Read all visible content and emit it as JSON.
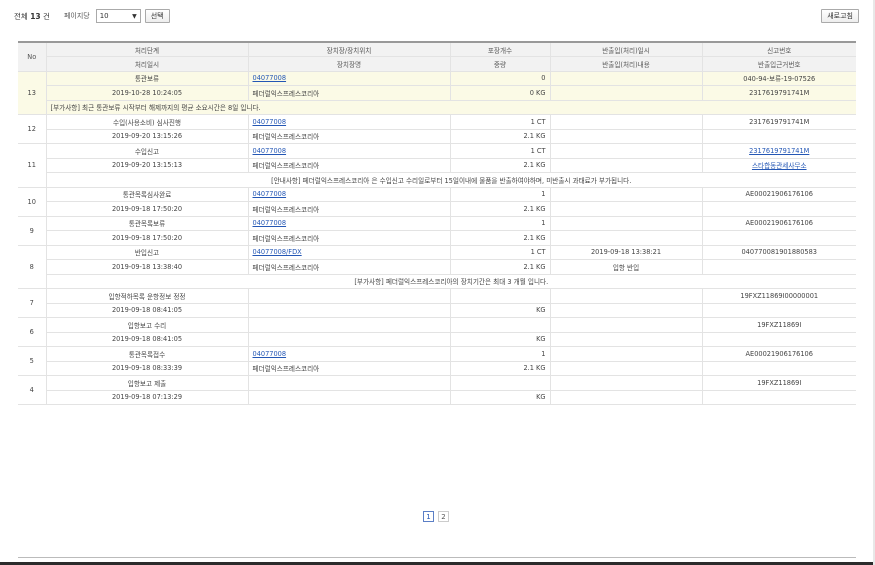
{
  "toolbar": {
    "total_prefix": "전체",
    "total_count": "13",
    "total_suffix": "건",
    "per_page_label": "페이지당",
    "per_page_value": "10",
    "select_button": "선택",
    "refresh_button": "새로고침"
  },
  "table": {
    "headers": {
      "no": "No",
      "row1": [
        "처리단계",
        "장치장/장치위치",
        "포장개수",
        "반출입(처리)일시",
        "신고번호"
      ],
      "row2": [
        "처리일시",
        "장치장명",
        "중량",
        "반출입(처리)내용",
        "반출입근거번호"
      ]
    },
    "records": [
      {
        "no": "13",
        "highlight": true,
        "step": "통관보류",
        "location": "04077008",
        "location_link": true,
        "count": "0",
        "io_datetime": "",
        "decl_no": "040-94-보류-19-07526",
        "decl_link": false,
        "datetime": "2019-10-28 10:24:05",
        "warehouse": "페더럴익스프레스코리아",
        "weight": "0 KG",
        "io_content": "",
        "basis_no": "2317619791741M",
        "basis_link": false,
        "notice": "[부가사항] 최근 통관보류 시작부터 해제까지의 평균 소요시간은 8일 입니다."
      },
      {
        "no": "12",
        "highlight": false,
        "step": "수입(사용소비) 심사진행",
        "location": "04077008",
        "location_link": true,
        "count": "1 CT",
        "io_datetime": "",
        "decl_no": "2317619791741M",
        "decl_link": false,
        "datetime": "2019-09-20 13:15:26",
        "warehouse": "페더럴익스프레스코리아",
        "weight": "2.1 KG",
        "io_content": "",
        "basis_no": "",
        "basis_link": false,
        "notice": ""
      },
      {
        "no": "11",
        "highlight": false,
        "step": "수입신고",
        "location": "04077008",
        "location_link": true,
        "count": "1 CT",
        "io_datetime": "",
        "decl_no": "2317619791741M",
        "decl_link": true,
        "datetime": "2019-09-20 13:15:13",
        "warehouse": "페더럴익스프레스코리아",
        "weight": "2.1 KG",
        "io_content": "",
        "basis_no": "스타합동관세사무소",
        "basis_link": true,
        "notice": "[안내사항] 페더럴익스프레스코리아 은 수입신고 수리일로부터 15일이내에 물품을 반출하여야하며, 미반출시 과태료가 부가됩니다."
      },
      {
        "no": "10",
        "highlight": false,
        "step": "통관목록심사완료",
        "location": "04077008",
        "location_link": true,
        "count": "1",
        "io_datetime": "",
        "decl_no": "AE00021906176106",
        "decl_link": false,
        "datetime": "2019-09-18 17:50:20",
        "warehouse": "페더럴익스프레스코리아",
        "weight": "2.1 KG",
        "io_content": "",
        "basis_no": "",
        "basis_link": false,
        "notice": ""
      },
      {
        "no": "9",
        "highlight": false,
        "step": "통관목록보류",
        "location": "04077008",
        "location_link": true,
        "count": "1",
        "io_datetime": "",
        "decl_no": "AE00021906176106",
        "decl_link": false,
        "datetime": "2019-09-18 17:50:20",
        "warehouse": "페더럴익스프레스코리아",
        "weight": "2.1 KG",
        "io_content": "",
        "basis_no": "",
        "basis_link": false,
        "notice": ""
      },
      {
        "no": "8",
        "highlight": false,
        "step": "반입신고",
        "location": "04077008/FDX",
        "location_link": true,
        "count": "1 CT",
        "io_datetime": "2019-09-18 13:38:21",
        "decl_no": "040770081901880583",
        "decl_link": false,
        "datetime": "2019-09-18 13:38:40",
        "warehouse": "페더럴익스프레스코리아",
        "weight": "2.1 KG",
        "io_content": "입항 반입",
        "basis_no": "",
        "basis_link": false,
        "notice": "[부가사항] 페더럴익스프레스코리아의 장치기간은 최대 3 개월 입니다."
      },
      {
        "no": "7",
        "highlight": false,
        "step": "입항적하목록 운항정보 정정",
        "location": "",
        "location_link": false,
        "count": "",
        "io_datetime": "",
        "decl_no": "19FXZ11869I00000001",
        "decl_link": false,
        "datetime": "2019-09-18 08:41:05",
        "warehouse": "",
        "weight": "KG",
        "io_content": "",
        "basis_no": "",
        "basis_link": false,
        "notice": ""
      },
      {
        "no": "6",
        "highlight": false,
        "step": "입항보고 수리",
        "location": "",
        "location_link": false,
        "count": "",
        "io_datetime": "",
        "decl_no": "19FXZ11869I",
        "decl_link": false,
        "datetime": "2019-09-18 08:41:05",
        "warehouse": "",
        "weight": "KG",
        "io_content": "",
        "basis_no": "",
        "basis_link": false,
        "notice": ""
      },
      {
        "no": "5",
        "highlight": false,
        "step": "통관목록접수",
        "location": "04077008",
        "location_link": true,
        "count": "1",
        "io_datetime": "",
        "decl_no": "AE00021906176106",
        "decl_link": false,
        "datetime": "2019-09-18 08:33:39",
        "warehouse": "페더럴익스프레스코리아",
        "weight": "2.1 KG",
        "io_content": "",
        "basis_no": "",
        "basis_link": false,
        "notice": ""
      },
      {
        "no": "4",
        "highlight": false,
        "step": "입항보고 제출",
        "location": "",
        "location_link": false,
        "count": "",
        "io_datetime": "",
        "decl_no": "19FXZ11869I",
        "decl_link": false,
        "datetime": "2019-09-18 07:13:29",
        "warehouse": "",
        "weight": "KG",
        "io_content": "",
        "basis_no": "",
        "basis_link": false,
        "notice": ""
      }
    ]
  },
  "pagination": {
    "pages": [
      "1",
      "2"
    ],
    "current": "1"
  }
}
